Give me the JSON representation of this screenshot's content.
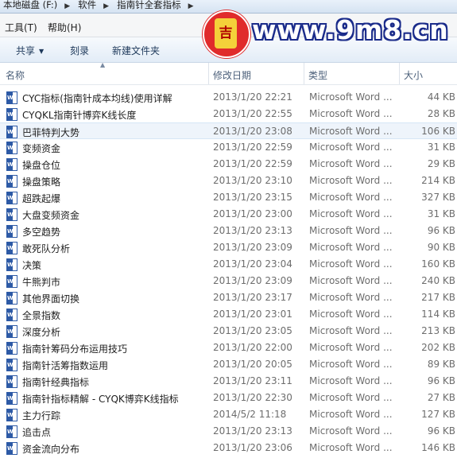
{
  "address_bar": {
    "segments": [
      "本地磁盘 (F:)",
      "软件",
      "指南针全套指标"
    ],
    "separator": "▶"
  },
  "menu": {
    "tools": "工具(T)",
    "help": "帮助(H)"
  },
  "toolbar": {
    "share": "共享",
    "burn": "刻录",
    "new_folder": "新建文件夹"
  },
  "watermark": {
    "logo_text": "吉",
    "site": "www.9m8.cn"
  },
  "columns": {
    "name": "名称",
    "date": "修改日期",
    "type": "类型",
    "size": "大小"
  },
  "files": [
    {
      "name": "CYC指标(指南针成本均线)使用详解",
      "date": "2013/1/20 22:21",
      "type": "Microsoft Word ...",
      "size": "44 KB"
    },
    {
      "name": "CYQKL指南针博弈K线长度",
      "date": "2013/1/20 22:55",
      "type": "Microsoft Word ...",
      "size": "28 KB"
    },
    {
      "name": "巴菲特判大势",
      "date": "2013/1/20 23:08",
      "type": "Microsoft Word ...",
      "size": "106 KB"
    },
    {
      "name": "变频资金",
      "date": "2013/1/20 22:59",
      "type": "Microsoft Word ...",
      "size": "31 KB"
    },
    {
      "name": "操盘仓位",
      "date": "2013/1/20 22:59",
      "type": "Microsoft Word ...",
      "size": "29 KB"
    },
    {
      "name": "操盘策略",
      "date": "2013/1/20 23:10",
      "type": "Microsoft Word ...",
      "size": "214 KB"
    },
    {
      "name": "超跌起爆",
      "date": "2013/1/20 23:15",
      "type": "Microsoft Word ...",
      "size": "327 KB"
    },
    {
      "name": "大盘变频资金",
      "date": "2013/1/20 23:00",
      "type": "Microsoft Word ...",
      "size": "31 KB"
    },
    {
      "name": "多空趋势",
      "date": "2013/1/20 23:13",
      "type": "Microsoft Word ...",
      "size": "96 KB"
    },
    {
      "name": "敢死队分析",
      "date": "2013/1/20 23:09",
      "type": "Microsoft Word ...",
      "size": "90 KB"
    },
    {
      "name": "决策",
      "date": "2013/1/20 23:04",
      "type": "Microsoft Word ...",
      "size": "160 KB"
    },
    {
      "name": "牛熊判市",
      "date": "2013/1/20 23:09",
      "type": "Microsoft Word ...",
      "size": "240 KB"
    },
    {
      "name": "其他界面切换",
      "date": "2013/1/20 23:17",
      "type": "Microsoft Word ...",
      "size": "217 KB"
    },
    {
      "name": "全景指数",
      "date": "2013/1/20 23:01",
      "type": "Microsoft Word ...",
      "size": "114 KB"
    },
    {
      "name": "深度分析",
      "date": "2013/1/20 23:05",
      "type": "Microsoft Word ...",
      "size": "213 KB"
    },
    {
      "name": "指南针筹码分布运用技巧",
      "date": "2013/1/20 22:00",
      "type": "Microsoft Word ...",
      "size": "202 KB"
    },
    {
      "name": "指南针活筹指数运用",
      "date": "2013/1/20 20:05",
      "type": "Microsoft Word ...",
      "size": "89 KB"
    },
    {
      "name": "指南针经典指标",
      "date": "2013/1/20 23:11",
      "type": "Microsoft Word ...",
      "size": "96 KB"
    },
    {
      "name": "指南针指标精解 - CYQK博弈K线指标",
      "date": "2013/1/20 22:30",
      "type": "Microsoft Word ...",
      "size": "27 KB"
    },
    {
      "name": "主力行踪",
      "date": "2014/5/2 11:18",
      "type": "Microsoft Word ...",
      "size": "127 KB"
    },
    {
      "name": "追击点",
      "date": "2013/1/20 23:13",
      "type": "Microsoft Word ...",
      "size": "96 KB"
    },
    {
      "name": "资金流向分布",
      "date": "2013/1/20 23:06",
      "type": "Microsoft Word ...",
      "size": "146 KB"
    }
  ],
  "selected_index": 2
}
